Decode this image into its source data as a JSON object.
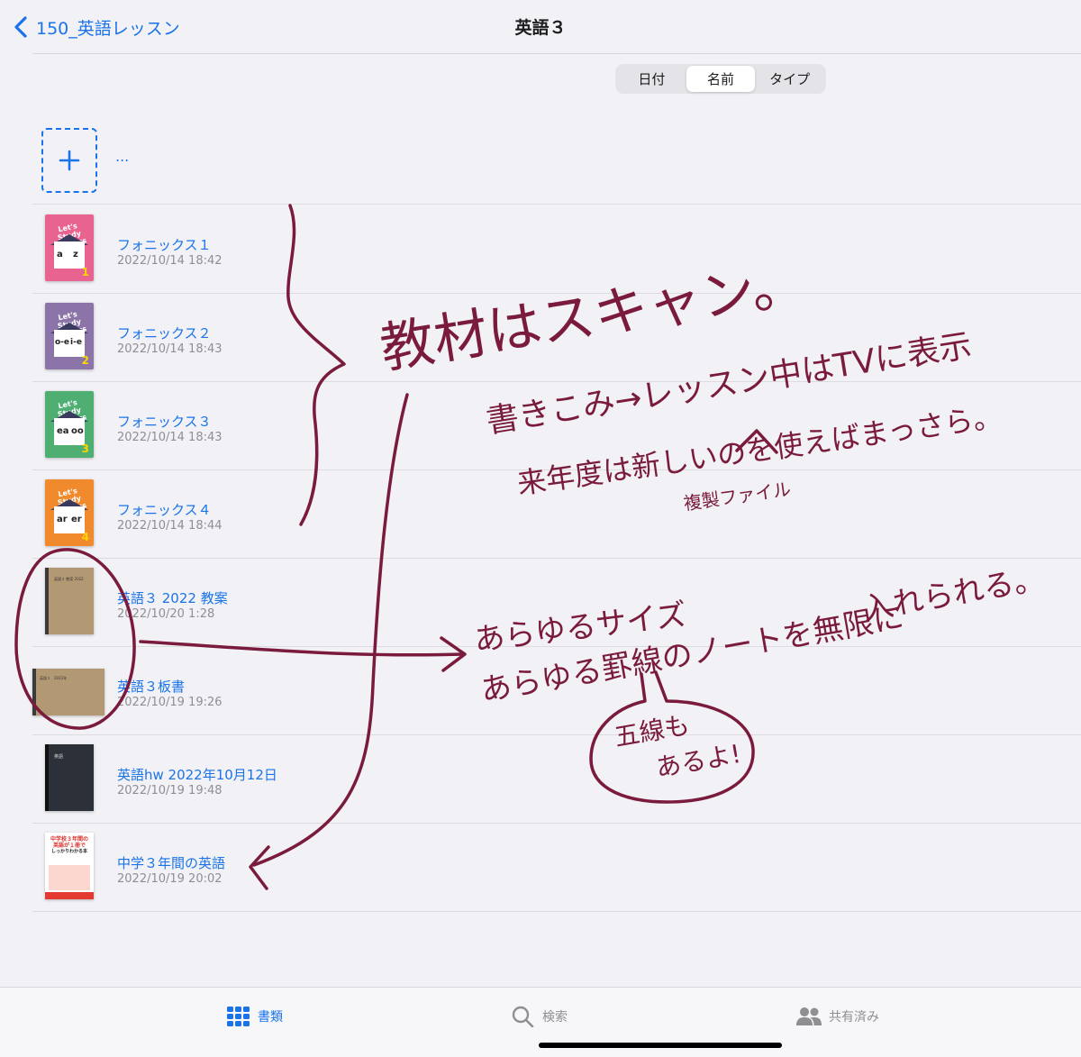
{
  "nav": {
    "back_label": "150_英語レッスン",
    "title": "英語３"
  },
  "sort": {
    "options": [
      "日付",
      "名前",
      "タイプ"
    ],
    "selected": "名前"
  },
  "new_item": {
    "ellipsis": "..."
  },
  "documents": [
    {
      "title": "フォニックス１",
      "date": "2022/10/14 18:42",
      "cover": "phonics-pink"
    },
    {
      "title": "フォニックス２",
      "date": "2022/10/14 18:43",
      "cover": "phonics-purple"
    },
    {
      "title": "フォニックス３",
      "date": "2022/10/14 18:43",
      "cover": "phonics-green"
    },
    {
      "title": "フォニックス４",
      "date": "2022/10/14 18:44",
      "cover": "phonics-orange"
    },
    {
      "title": "英語３ 2022 教案",
      "date": "2022/10/20 1:28",
      "cover": "kraft-notebook"
    },
    {
      "title": "英語３板書",
      "date": "2022/10/19 19:26",
      "cover": "kraft-landscape"
    },
    {
      "title": "英語hw 2022年10月12日",
      "date": "2022/10/19 19:48",
      "cover": "dark-notebook"
    },
    {
      "title": "中学３年間の英語",
      "date": "2022/10/19 20:02",
      "cover": "book-red"
    }
  ],
  "covers": {
    "phonics_caption": "Let's Study Phonics",
    "phonics_letters": [
      [
        "a",
        "z"
      ],
      [
        "o-e",
        "i-e"
      ],
      [
        "ea",
        "oo"
      ],
      [
        "ar",
        "er"
      ]
    ],
    "phonics_numbers": [
      "1",
      "2",
      "3",
      "4"
    ],
    "kraft_label": "英語３ 教案 2022",
    "kraft_landscape_label": "英語３　2022年",
    "dark_label": "英語",
    "book_lines": [
      "中学校３年間の",
      "英語が１冊で",
      "しっかりわかる本"
    ]
  },
  "tabbar": {
    "items": [
      {
        "label": "書類",
        "icon": "grid-icon",
        "active": true
      },
      {
        "label": "検索",
        "icon": "search-icon",
        "active": false
      },
      {
        "label": "共有済み",
        "icon": "people-icon",
        "active": false
      }
    ]
  },
  "annotations": {
    "line1": "教材はスキャン。",
    "line2": "書きこみ→レッスン中はTVに表示",
    "line3": "来年度は新しいのを使えばまっさら。",
    "line3_note": "複製ファイル",
    "line4": "あらゆるサイズ",
    "line5": "あらゆる罫線のノートを無限に",
    "line5b": "入れられる。",
    "bubble1": "五線も",
    "bubble2": "あるよ!"
  },
  "colors": {
    "accent": "#1a73e8",
    "ink": "#7a1a3c",
    "background": "#f2f2f6"
  }
}
